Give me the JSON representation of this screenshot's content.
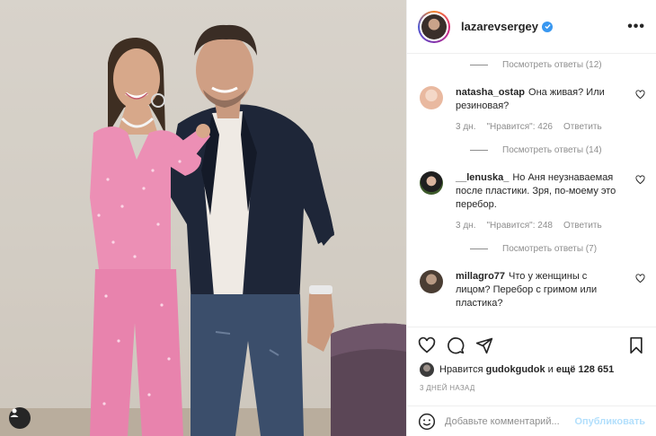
{
  "post": {
    "username": "lazarevsergey",
    "verified": true,
    "more_label": "•••"
  },
  "comments": {
    "view_replies": [
      "Посмотреть ответы (12)",
      "Посмотреть ответы (14)",
      "Посмотреть ответы (7)"
    ],
    "items": [
      {
        "user": "natasha_ostap",
        "text": "Она живая? Или резиновая?",
        "time": "3 дн.",
        "likes": "\"Нравится\": 426",
        "reply": "Ответить",
        "avatar_color": "#e9b9a0"
      },
      {
        "user": "__lenuska_",
        "text": "Но Аня неузнаваемая после пластики. Зря, по-моему это перебор.",
        "time": "3 дн.",
        "likes": "\"Нравится\": 248",
        "reply": "Ответить",
        "avatar_color": "#3d5a2a"
      },
      {
        "user": "millagro77",
        "text": "Что у женщины с лицом? Перебор с гримом или пластика?",
        "time": "",
        "likes": "",
        "reply": "",
        "avatar_color": "#6b5a4a"
      }
    ]
  },
  "likes": {
    "prefix": "Нравится",
    "user": "gudokgudok",
    "conjunction": "и",
    "rest": "ещё 128 651"
  },
  "date": "3 ДНЕЙ НАЗАД",
  "add_comment": {
    "placeholder": "Добавьте комментарий...",
    "publish_label": "Опубликовать"
  },
  "colors": {
    "accent": "#3897f0",
    "publish_disabled": "#b2dffc",
    "secondary_text": "#8e8e8e",
    "primary_text": "#262626",
    "suit_pink": "#ec8fb5",
    "jacket_navy": "#1e2638"
  },
  "icons": {
    "verified": "verified-badge-icon",
    "heart": "heart-icon",
    "comment": "comment-icon",
    "share": "share-icon",
    "save": "bookmark-icon",
    "emoji": "emoji-icon",
    "user_tag": "user-tag-icon",
    "more": "more-options-icon"
  }
}
